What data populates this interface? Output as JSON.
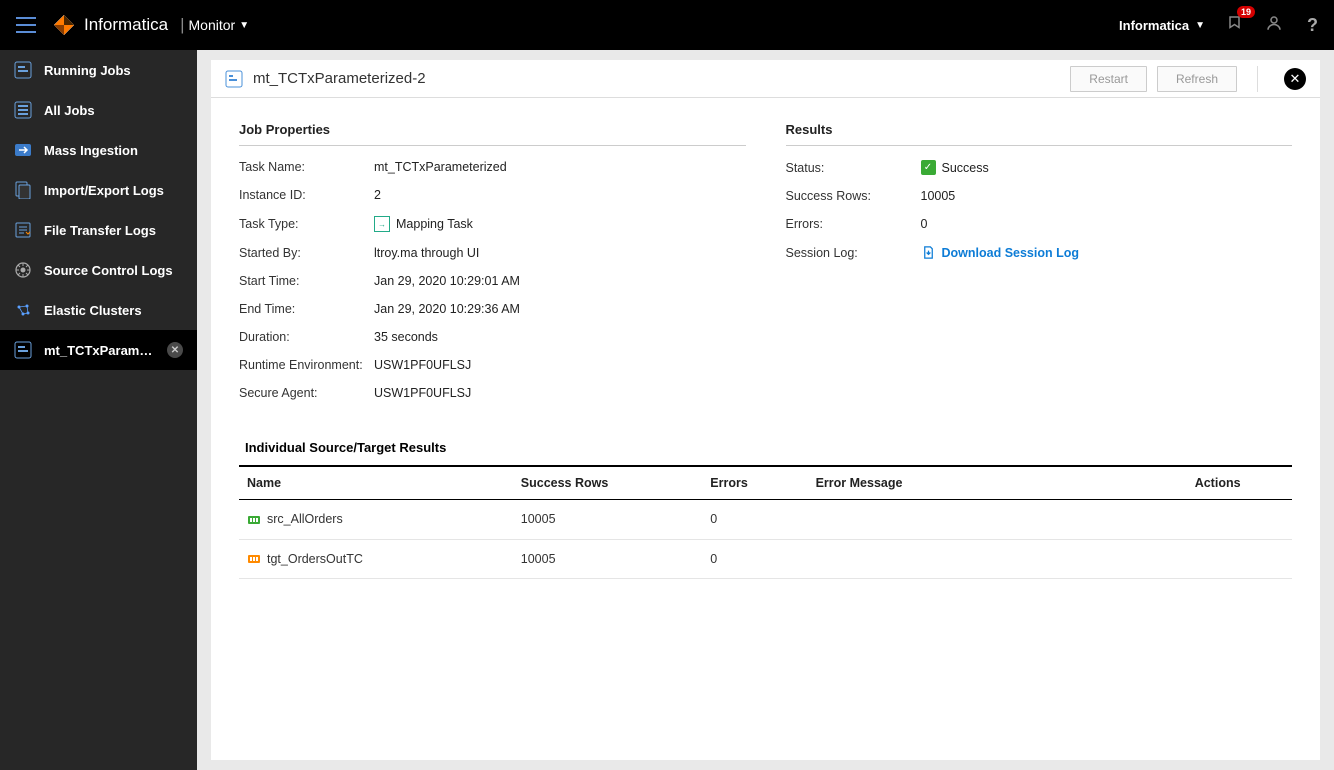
{
  "topbar": {
    "brand": "Informatica",
    "app": "Monitor",
    "org": "Informatica",
    "notifications": "19"
  },
  "sidebar": {
    "items": [
      {
        "label": "Running Jobs"
      },
      {
        "label": "All Jobs"
      },
      {
        "label": "Mass Ingestion"
      },
      {
        "label": "Import/Export Logs"
      },
      {
        "label": "File Transfer Logs"
      },
      {
        "label": "Source Control Logs"
      },
      {
        "label": "Elastic Clusters"
      },
      {
        "label": "mt_TCTxParameteri...",
        "active": true,
        "closable": true
      }
    ]
  },
  "page": {
    "title": "mt_TCTxParameterized-2",
    "restart": "Restart",
    "refresh": "Refresh"
  },
  "jobprops": {
    "title": "Job Properties",
    "task_name_l": "Task Name:",
    "task_name": "mt_TCTxParameterized",
    "instance_l": "Instance ID:",
    "instance": "2",
    "type_l": "Task Type:",
    "type": "Mapping Task",
    "started_l": "Started By:",
    "started": "ltroy.ma through UI",
    "start_l": "Start Time:",
    "start": "Jan 29, 2020 10:29:01 AM",
    "end_l": "End Time:",
    "end": "Jan 29, 2020 10:29:36 AM",
    "dur_l": "Duration:",
    "dur": "35 seconds",
    "env_l": "Runtime Environment:",
    "env": "USW1PF0UFLSJ",
    "agent_l": "Secure Agent:",
    "agent": "USW1PF0UFLSJ"
  },
  "results": {
    "title": "Results",
    "status_l": "Status:",
    "status": "Success",
    "succ_l": "Success Rows:",
    "succ": "10005",
    "err_l": "Errors:",
    "err": "0",
    "log_l": "Session Log:",
    "log": "Download Session Log"
  },
  "table": {
    "title": "Individual Source/Target Results",
    "cols": {
      "name": "Name",
      "succ": "Success Rows",
      "err": "Errors",
      "msg": "Error Message",
      "act": "Actions"
    },
    "rows": [
      {
        "name": "src_AllOrders",
        "succ": "10005",
        "err": "0",
        "msg": "",
        "type": "src"
      },
      {
        "name": "tgt_OrdersOutTC",
        "succ": "10005",
        "err": "0",
        "msg": "",
        "type": "tgt"
      }
    ]
  }
}
